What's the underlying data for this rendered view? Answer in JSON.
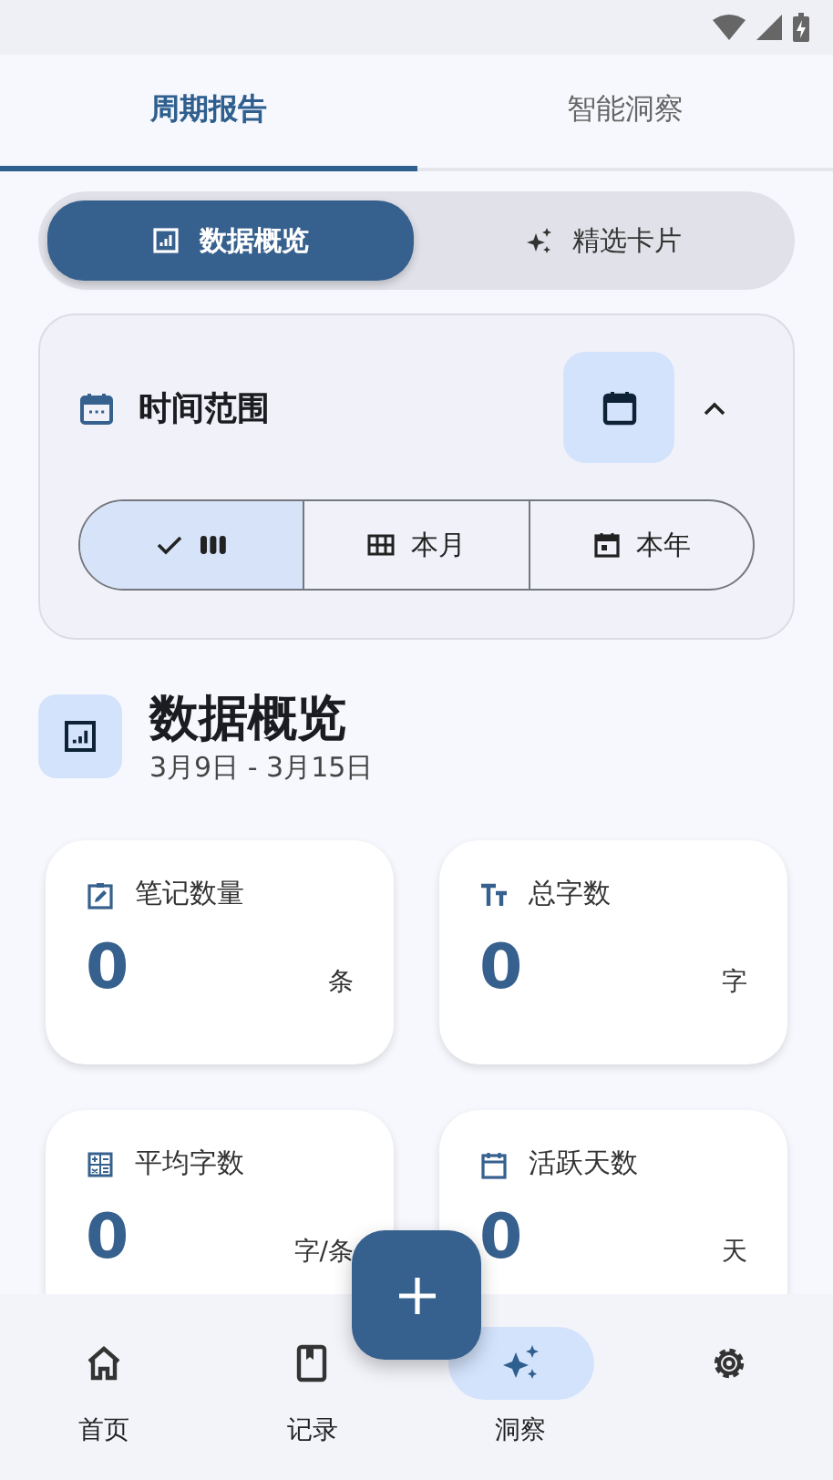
{
  "tabs": [
    {
      "label": "周期报告",
      "selected": true
    },
    {
      "label": "智能洞察",
      "selected": false
    }
  ],
  "view_switch": [
    {
      "label": "数据概览",
      "selected": true
    },
    {
      "label": "精选卡片",
      "selected": false
    }
  ],
  "time_range": {
    "title": "时间范围",
    "expanded": true,
    "segments": [
      {
        "selected": true
      },
      {
        "label": "本月",
        "selected": false
      },
      {
        "label": "本年",
        "selected": false
      }
    ]
  },
  "overview": {
    "title": "数据概览",
    "subtitle": "3月9日 - 3月15日"
  },
  "stats": [
    {
      "label": "笔记数量",
      "value": "0",
      "unit": "条"
    },
    {
      "label": "总字数",
      "value": "0",
      "unit": "字"
    },
    {
      "label": "平均字数",
      "value": "0",
      "unit": "字/条"
    },
    {
      "label": "活跃天数",
      "value": "0",
      "unit": "天"
    }
  ],
  "nav": [
    {
      "label": "首页",
      "selected": false
    },
    {
      "label": "记录",
      "selected": false
    },
    {
      "label": "洞察",
      "selected": true
    },
    {
      "selected": false
    }
  ]
}
